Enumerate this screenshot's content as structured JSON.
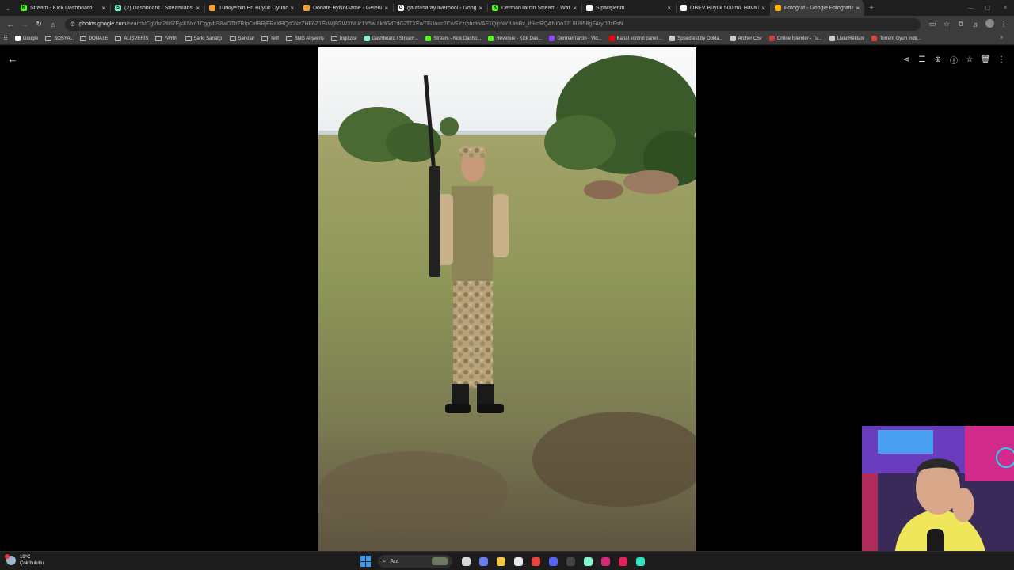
{
  "browser": {
    "tabs": [
      {
        "title": "Stream - Kick Dashboard",
        "favicon_color": "#53fc18",
        "favicon_letter": "K",
        "active": false
      },
      {
        "title": "(2) Dashboard / Streamlabs",
        "favicon_color": "#80f5d2",
        "favicon_letter": "S",
        "active": false
      },
      {
        "title": "Türkiye'nin En Büyük Oyuncu D",
        "favicon_color": "#f2a23a",
        "favicon_letter": "",
        "active": false
      },
      {
        "title": "Donate ByNoGame - Gelen/Gi",
        "favicon_color": "#f2a23a",
        "favicon_letter": "",
        "active": false
      },
      {
        "title": "galatasaray liverpool - Google",
        "favicon_color": "#ffffff",
        "favicon_letter": "G",
        "active": false
      },
      {
        "title": "DermanTarcin Stream - Watch",
        "favicon_color": "#53fc18",
        "favicon_letter": "K",
        "active": false
      },
      {
        "title": "Siparişlerim",
        "favicon_color": "#ffffff",
        "favicon_letter": "",
        "active": false
      },
      {
        "title": "OBEV Büyük 500 mL Hava Nem",
        "favicon_color": "#ffffff",
        "favicon_letter": "",
        "active": false
      },
      {
        "title": "Fotoğraf - Google Fotoğraflar",
        "favicon_color": "#f4b400",
        "favicon_letter": "",
        "active": true
      }
    ],
    "close_glyph": "×",
    "new_tab_glyph": "+",
    "url_host": "photos.google.com",
    "url_path": "/search/CgVhc2tlcl7EjkKNxo1CggvbS8wOTltZBIpCidBRjFRaXBQd0NzZHF6Z1FkWjFGWXNUc1Y5aUlkdGdTdGZfTXEwTFUo<c2CwSYz/photo/AF1QipNYrUmBv_ihHdRQANI0o12L8U958gFAryDJzFsN",
    "bookmarks": [
      {
        "label": "Google",
        "kind": "icon",
        "color": "#ffffff"
      },
      {
        "label": "SOSYAL",
        "kind": "folder",
        "color": ""
      },
      {
        "label": "DONATE",
        "kind": "folder",
        "color": ""
      },
      {
        "label": "ALIŞVERİŞ",
        "kind": "folder",
        "color": ""
      },
      {
        "label": "YAYIN",
        "kind": "folder",
        "color": ""
      },
      {
        "label": "Şarkı Sanatçı",
        "kind": "folder",
        "color": ""
      },
      {
        "label": "Şarkılar",
        "kind": "folder",
        "color": ""
      },
      {
        "label": "Telif",
        "kind": "folder",
        "color": ""
      },
      {
        "label": "BNG Alışveriş",
        "kind": "folder",
        "color": ""
      },
      {
        "label": "İngilizce",
        "kind": "folder",
        "color": ""
      },
      {
        "label": "Dashboard / Stream...",
        "kind": "icon",
        "color": "#80f5d2"
      },
      {
        "label": "Stream - Kick Dashb...",
        "kind": "icon",
        "color": "#53fc18"
      },
      {
        "label": "Revenue - Kick Das...",
        "kind": "icon",
        "color": "#53fc18"
      },
      {
        "label": "DermanTarcin - Vid...",
        "kind": "icon",
        "color": "#9146ff"
      },
      {
        "label": "Kanal kontrol paneli...",
        "kind": "icon",
        "color": "#ff0000"
      },
      {
        "label": "Speedtest by Ookla...",
        "kind": "icon",
        "color": "#cccccc"
      },
      {
        "label": "Archer C5v",
        "kind": "icon",
        "color": "#cccccc"
      },
      {
        "label": "Online İşlemler - Tu...",
        "kind": "icon",
        "color": "#d03a3a"
      },
      {
        "label": "LivadReklam",
        "kind": "icon",
        "color": "#cccccc"
      },
      {
        "label": "Torrent Oyun indir...",
        "kind": "icon",
        "color": "#e04040"
      }
    ],
    "bookmarks_more_glyph": "»"
  },
  "viewer": {
    "back_glyph": "←",
    "actions": [
      {
        "name": "share-icon",
        "glyph": "⋖"
      },
      {
        "name": "edit-tune-icon",
        "glyph": "☰"
      },
      {
        "name": "zoom-icon",
        "glyph": "⊕"
      },
      {
        "name": "info-icon",
        "glyph": "ⓘ"
      },
      {
        "name": "favorite-star-icon",
        "glyph": "☆"
      },
      {
        "name": "delete-icon",
        "glyph": "🗑"
      },
      {
        "name": "more-vert-icon",
        "glyph": "⋮"
      }
    ]
  },
  "taskbar": {
    "temperature": "19°C",
    "weather_text": "Çok bulutlu",
    "search_placeholder": "Ara",
    "apps": [
      {
        "name": "task-view-icon",
        "color": "#d8d8d8"
      },
      {
        "name": "copilot-icon",
        "color": "#6a7cf0"
      },
      {
        "name": "file-explorer-icon",
        "color": "#f4c542"
      },
      {
        "name": "store-icon",
        "color": "#e8e8e8"
      },
      {
        "name": "chrome-icon",
        "color": "#e8453c"
      },
      {
        "name": "discord-icon",
        "color": "#5865f2"
      },
      {
        "name": "obs-icon",
        "color": "#444444"
      },
      {
        "name": "streamlabs-icon",
        "color": "#80f5d2"
      },
      {
        "name": "instagram-icon",
        "color": "#d62976"
      },
      {
        "name": "x-close-app-icon",
        "color": "#e0245e"
      },
      {
        "name": "search-app-icon",
        "color": "#2ee6c0"
      }
    ]
  }
}
